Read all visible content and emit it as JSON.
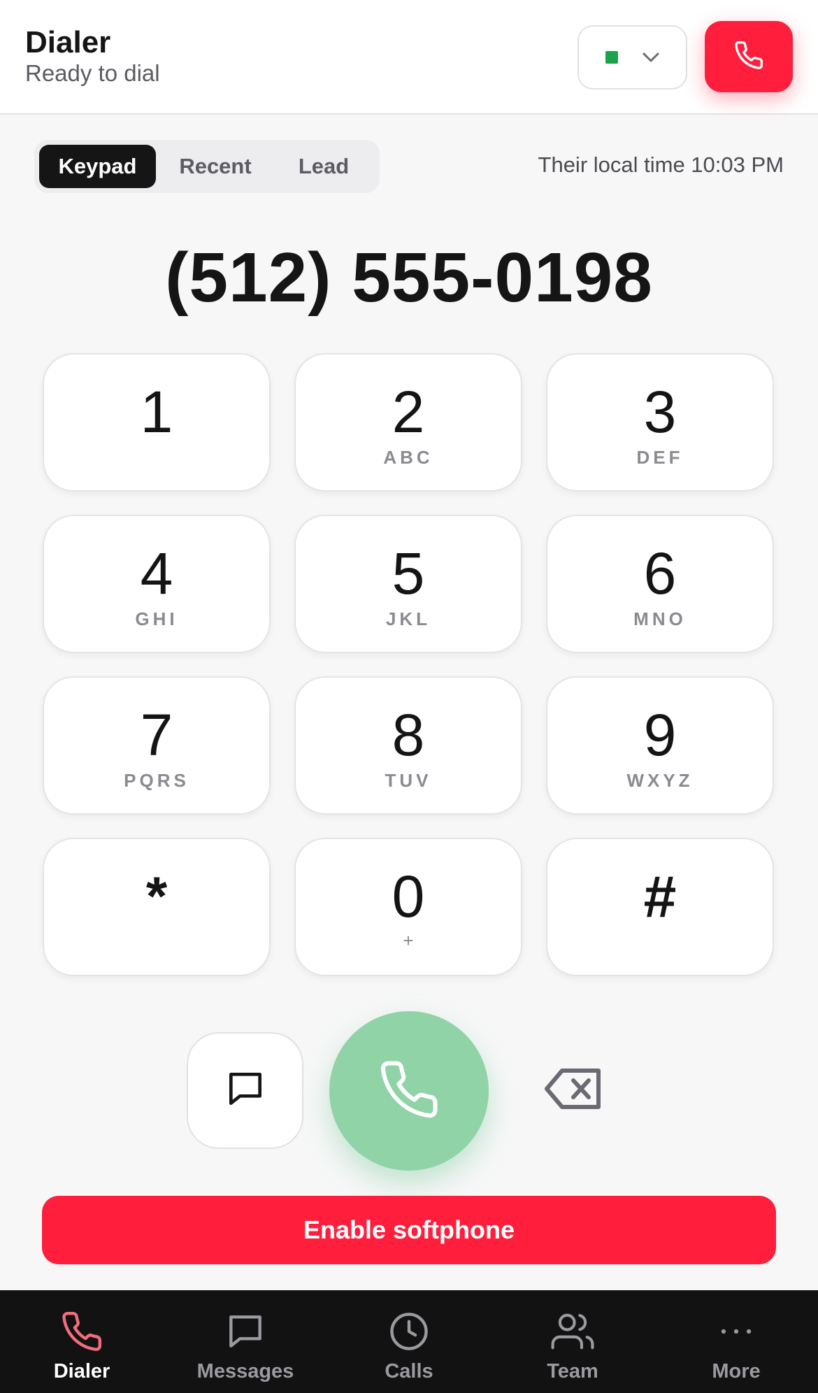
{
  "header": {
    "title": "Dialer",
    "subtitle": "Ready to dial",
    "line_status_color": "#1aa34a",
    "hangup_icon": "phone-icon"
  },
  "tabs": [
    {
      "label": "Keypad",
      "active": true
    },
    {
      "label": "Recent",
      "active": false
    },
    {
      "label": "Lead",
      "active": false
    }
  ],
  "local_time": "Their local time 10:03 PM",
  "dialed_number": "(512) 555-0198",
  "keypad": [
    {
      "digit": "1",
      "letters": ""
    },
    {
      "digit": "2",
      "letters": "ABC"
    },
    {
      "digit": "3",
      "letters": "DEF"
    },
    {
      "digit": "4",
      "letters": "GHI"
    },
    {
      "digit": "5",
      "letters": "JKL"
    },
    {
      "digit": "6",
      "letters": "MNO"
    },
    {
      "digit": "7",
      "letters": "PQRS"
    },
    {
      "digit": "8",
      "letters": "TUV"
    },
    {
      "digit": "9",
      "letters": "WXYZ"
    },
    {
      "digit": "*",
      "letters": ""
    },
    {
      "digit": "0",
      "letters": "+"
    },
    {
      "digit": "#",
      "letters": ""
    }
  ],
  "softphone_button": "Enable softphone",
  "bottom_nav": [
    {
      "label": "Dialer",
      "icon": "phone-icon",
      "active": true
    },
    {
      "label": "Messages",
      "icon": "message-icon",
      "active": false
    },
    {
      "label": "Calls",
      "icon": "clock-icon",
      "active": false
    },
    {
      "label": "Team",
      "icon": "users-icon",
      "active": false
    },
    {
      "label": "More",
      "icon": "more-icon",
      "active": false
    }
  ],
  "colors": {
    "accent_red": "#ff1f3d",
    "call_green": "#8fd3a6",
    "nav_background": "#121212"
  }
}
